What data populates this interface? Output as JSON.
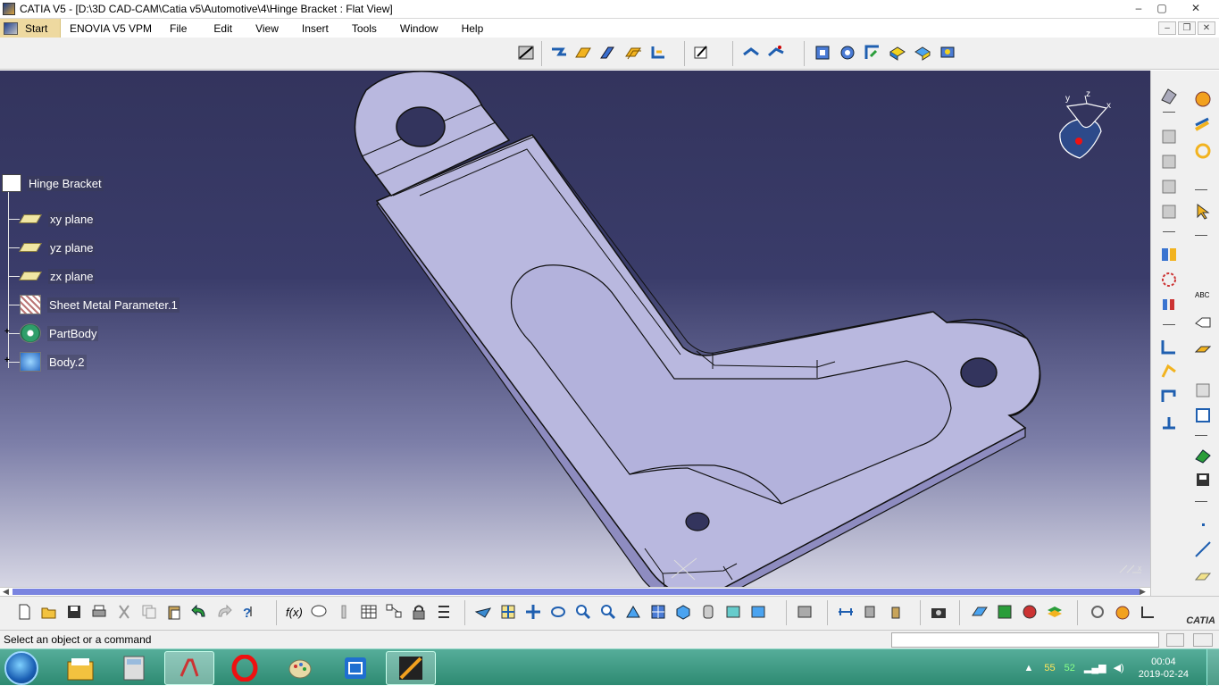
{
  "window": {
    "title": "CATIA V5 - [D:\\3D CAD-CAM\\Catia v5\\Automotive\\4\\Hinge Bracket : Flat View]",
    "controls": [
      "–",
      "▢",
      "✕"
    ]
  },
  "menubar": {
    "start": "Start",
    "items": [
      "ENOVIA V5 VPM",
      "File",
      "Edit",
      "View",
      "Insert",
      "Tools",
      "Window",
      "Help"
    ]
  },
  "tree": {
    "root": "Hinge Bracket",
    "items": [
      {
        "label": "xy plane",
        "icon": "plane-icon"
      },
      {
        "label": "yz plane",
        "icon": "plane-icon"
      },
      {
        "label": "zx plane",
        "icon": "plane-icon"
      },
      {
        "label": "Sheet Metal Parameter.1",
        "icon": "sheet-metal-parameter-icon"
      },
      {
        "label": "PartBody",
        "icon": "partbody-gear-icon"
      },
      {
        "label": "Body.2",
        "icon": "body-icon"
      }
    ]
  },
  "compass": {
    "x": "x",
    "y": "y",
    "z": "z"
  },
  "axis_indicator": "x",
  "status": {
    "message": "Select an object or a command",
    "command_input_value": ""
  },
  "right_logo": "CATIA",
  "taskbar": {
    "apps": [
      "explorer-icon",
      "calculator-icon",
      "catia-icon",
      "opera-icon",
      "paint-icon",
      "screen-capture-icon",
      "media-icon"
    ],
    "tray_values": [
      "55",
      "52"
    ],
    "time": "00:04",
    "date": "2019-02-24"
  },
  "colors": {
    "viewport_top": "#33345d",
    "viewport_bottom": "#d6d6e4",
    "part_fill": "#b9b8df",
    "part_edge": "#111111",
    "scroll_thumb": "#7a84e0",
    "taskbar": "#3f9b84"
  }
}
